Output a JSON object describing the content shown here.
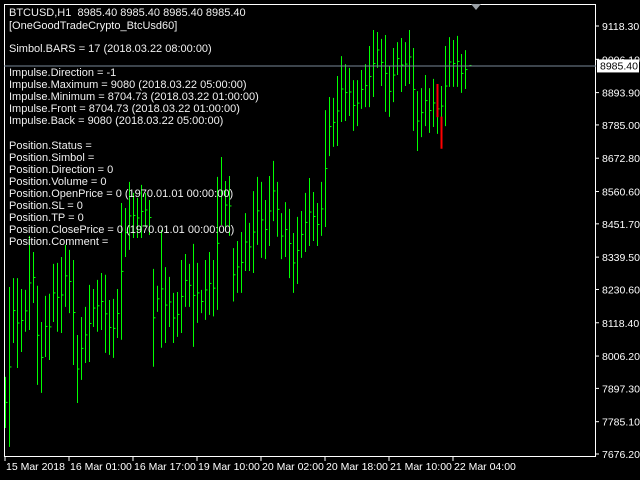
{
  "header": {
    "symbol_line": "BTCUSD,H1  8985.40 8985.40 8985.40 8985.40",
    "expert_name": "[OneGoodTradeCrypto_BtcUsd60]"
  },
  "info": {
    "bars_line": "Simbol.BARS = 17 (2018.03.22 08:00:00)",
    "impulse": [
      "Impulse.Direction = -1",
      "Impulse.Maximum = 9080 (2018.03.22 05:00:00)",
      "Impulse.Minimum = 8704.73 (2018.03.22 01:00:00)",
      "Impulse.Front = 8704.73 (2018.03.22 01:00:00)",
      "Impulse.Back = 9080 (2018.03.22 05:00:00)"
    ],
    "position": [
      "Position.Status =",
      "Position.Simbol =",
      "Position.Direction = 0",
      "Position.Volume = 0",
      "Position.OpenPrice = 0 (1970.01.01 00:00:00)",
      "Position.SL = 0",
      "Position.TP = 0",
      "Position.ClosePrice = 0 (1970.01.01 00:00:00)",
      "Position.Comment ="
    ]
  },
  "colors": {
    "background": "#000000",
    "bars": "#00ff00",
    "impulse": "#ff0000",
    "price_line": "#778899",
    "axis": "#ffffff"
  },
  "chart_data": {
    "type": "ohlc-bar",
    "symbol": "BTCUSD",
    "timeframe": "H1",
    "ylim": [
      7676.2,
      9118.3
    ],
    "y_ticks": [
      "9118.30",
      "9006.10",
      "8893.90",
      "8785.00",
      "8672.80",
      "8560.60",
      "8451.70",
      "8339.50",
      "8230.60",
      "8118.40",
      "8006.20",
      "7897.30",
      "7785.10",
      "7676.20"
    ],
    "current_price": "8985.40",
    "x_ticks": [
      "15 Mar 2018",
      "16 Mar 01:00",
      "16 Mar 17:00",
      "19 Mar 10:00",
      "20 Mar 02:00",
      "20 Mar 18:00",
      "21 Mar 10:00",
      "22 Mar 04:00"
    ],
    "bars_high_low": [
      [
        7936,
        7764
      ],
      [
        8239,
        7700
      ],
      [
        8269,
        8050
      ],
      [
        8269,
        7966
      ],
      [
        8232,
        8020
      ],
      [
        8229,
        8088
      ],
      [
        8411,
        8094
      ],
      [
        8357,
        8185
      ],
      [
        8243,
        7909
      ],
      [
        8121,
        7882
      ],
      [
        8209,
        8003
      ],
      [
        8216,
        7993
      ],
      [
        8317,
        8121
      ],
      [
        8320,
        8088
      ],
      [
        8340,
        8084
      ],
      [
        8381,
        8172
      ],
      [
        8364,
        8151
      ],
      [
        8330,
        7976
      ],
      [
        8077,
        7848
      ],
      [
        8138,
        7926
      ],
      [
        8172,
        7983
      ],
      [
        8246,
        7986
      ],
      [
        8232,
        8104
      ],
      [
        8263,
        8088
      ],
      [
        8286,
        8094
      ],
      [
        8280,
        8017
      ],
      [
        8195,
        8010
      ],
      [
        8199,
        8000
      ],
      [
        8232,
        8067
      ],
      [
        8522,
        8061
      ],
      [
        8505,
        8340
      ],
      [
        8593,
        8364
      ],
      [
        8556,
        8404
      ],
      [
        8539,
        8404
      ],
      [
        8583,
        8404
      ],
      [
        8556,
        8441
      ],
      [
        8532,
        8414
      ],
      [
        8300,
        7970
      ],
      [
        8243,
        8155
      ],
      [
        8431,
        8034
      ],
      [
        8306,
        8050
      ],
      [
        8273,
        8104
      ],
      [
        8219,
        8050
      ],
      [
        8222,
        8071
      ],
      [
        8330,
        8084
      ],
      [
        8350,
        8172
      ],
      [
        8317,
        8172
      ],
      [
        8384,
        8037
      ],
      [
        8320,
        8118
      ],
      [
        8229,
        8151
      ],
      [
        8330,
        8128
      ],
      [
        8357,
        8145
      ],
      [
        8330,
        8140
      ],
      [
        8610,
        8162
      ],
      [
        8677,
        8448
      ],
      [
        8596,
        8434
      ],
      [
        8613,
        8411
      ],
      [
        8370,
        8190
      ],
      [
        8394,
        8219
      ],
      [
        8424,
        8219
      ],
      [
        8488,
        8293
      ],
      [
        8455,
        8293
      ],
      [
        8562,
        8286
      ],
      [
        8610,
        8381
      ],
      [
        8593,
        8337
      ],
      [
        8532,
        8333
      ],
      [
        8613,
        8377
      ],
      [
        8664,
        8461
      ],
      [
        8593,
        8408
      ],
      [
        8488,
        8333
      ],
      [
        8525,
        8340
      ],
      [
        8502,
        8269
      ],
      [
        8421,
        8219
      ],
      [
        8475,
        8249
      ],
      [
        8495,
        8337
      ],
      [
        8556,
        8357
      ],
      [
        8606,
        8377
      ],
      [
        8559,
        8394
      ],
      [
        8522,
        8377
      ],
      [
        8593,
        8411
      ],
      [
        8835,
        8441
      ],
      [
        8879,
        8680
      ],
      [
        8876,
        8711
      ],
      [
        8950,
        8714
      ],
      [
        9017,
        8795
      ],
      [
        8990,
        8798
      ],
      [
        8977,
        8815
      ],
      [
        8936,
        8765
      ],
      [
        8936,
        8781
      ],
      [
        8970,
        8839
      ],
      [
        8990,
        8845
      ],
      [
        9051,
        8845
      ],
      [
        9105,
        8879
      ],
      [
        9098,
        8977
      ],
      [
        9075,
        8916
      ],
      [
        9088,
        8829
      ],
      [
        8984,
        8812
      ],
      [
        9044,
        8862
      ],
      [
        9064,
        8953
      ],
      [
        9078,
        8896
      ],
      [
        9064,
        8916
      ],
      [
        9105,
        8923
      ],
      [
        9044,
        8765
      ],
      [
        8899,
        8697
      ],
      [
        8909,
        8744
      ],
      [
        8953,
        8781
      ],
      [
        8909,
        8758
      ],
      [
        8940,
        8778
      ],
      [
        8923,
        8755
      ],
      [
        8916,
        8781
      ],
      [
        9051,
        8781
      ],
      [
        9081,
        8913
      ],
      [
        9071,
        8913
      ],
      [
        9085,
        8913
      ],
      [
        9024,
        8893
      ],
      [
        9037,
        8906
      ],
      [
        8985.4,
        8985.4
      ]
    ],
    "impulse_segments": [
      {
        "bar": 108,
        "high": 8923,
        "low": 8811
      },
      {
        "bar": 109,
        "high": 8813,
        "low": 8704.73
      }
    ]
  }
}
